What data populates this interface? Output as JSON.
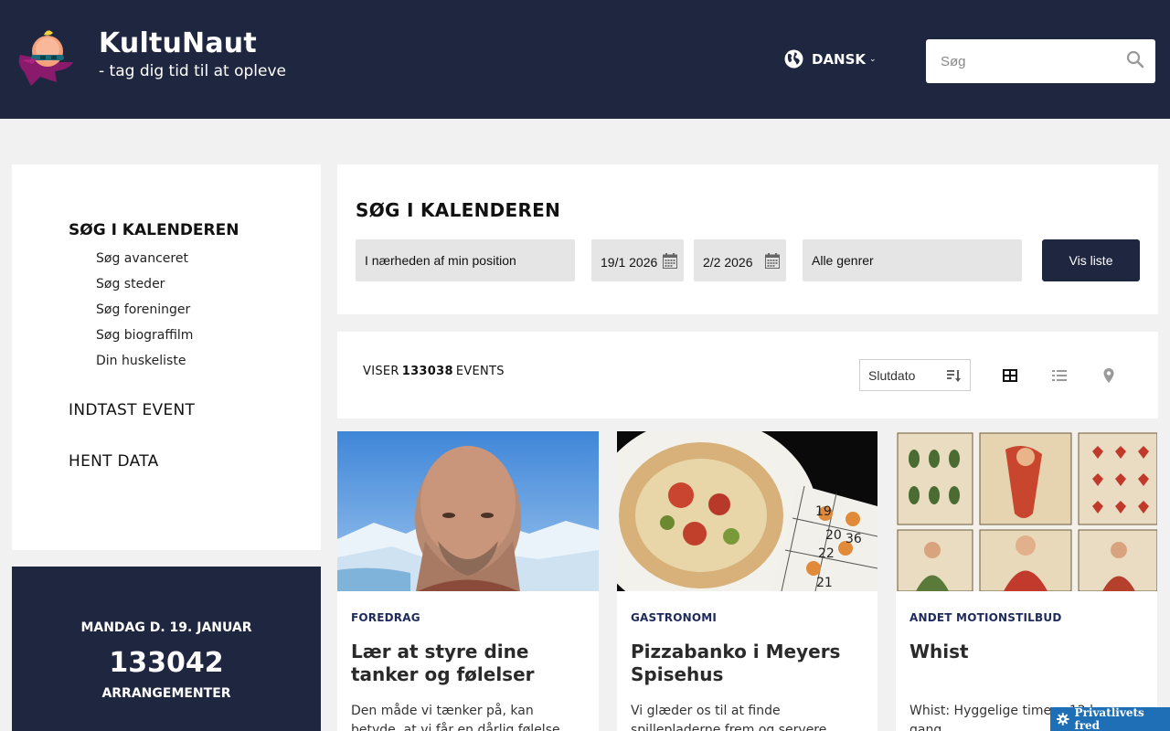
{
  "header": {
    "title": "KultuNaut",
    "subtitle": "- tag dig tid til at opleve",
    "language": "DANSK",
    "search_placeholder": "Søg"
  },
  "sidebar": {
    "heading": "SØG I KALENDEREN",
    "subitems": [
      "Søg avanceret",
      "Søg steder",
      "Søg foreninger",
      "Søg biograffilm",
      "Din huskeliste"
    ],
    "main_items": [
      "INDTAST EVENT",
      "HENT DATA"
    ]
  },
  "stats": {
    "date": "MANDAG D. 19. JANUAR",
    "count": "133042",
    "label": "ARRANGEMENTER"
  },
  "search_panel": {
    "title": "SØG I KALENDEREN",
    "location": "I nærheden af min position",
    "date_from": "19/1 2026",
    "date_to": "2/2 2026",
    "genre": "Alle genrer",
    "submit": "Vis liste"
  },
  "results": {
    "prefix": "VISER",
    "count": "133038",
    "suffix": "EVENTS",
    "sort": "Slutdato"
  },
  "cards": [
    {
      "category": "FOREDRAG",
      "title": "Lær at styre dine tanker og følelser",
      "description": "Den måde vi tænker på, kan betyde, at vi får en dårlig følelse"
    },
    {
      "category": "GASTRONOMI",
      "title": "Pizzabanko i Meyers Spisehus",
      "description": "Vi glæder os til at finde spillepladerne frem og servere"
    },
    {
      "category": "ANDET MOTIONSTILBUD",
      "title": "Whist",
      "description": "Whist: Hyggelige timer - 12 hver gang"
    }
  ],
  "bingo_numbers": [
    "19",
    "20",
    "36",
    "22",
    "21"
  ],
  "privacy": "Privatlivets fred",
  "colors": {
    "header_bg": "#1f2640",
    "accent": "#1f2a5c",
    "privacy_bg": "#1e6fb5"
  }
}
